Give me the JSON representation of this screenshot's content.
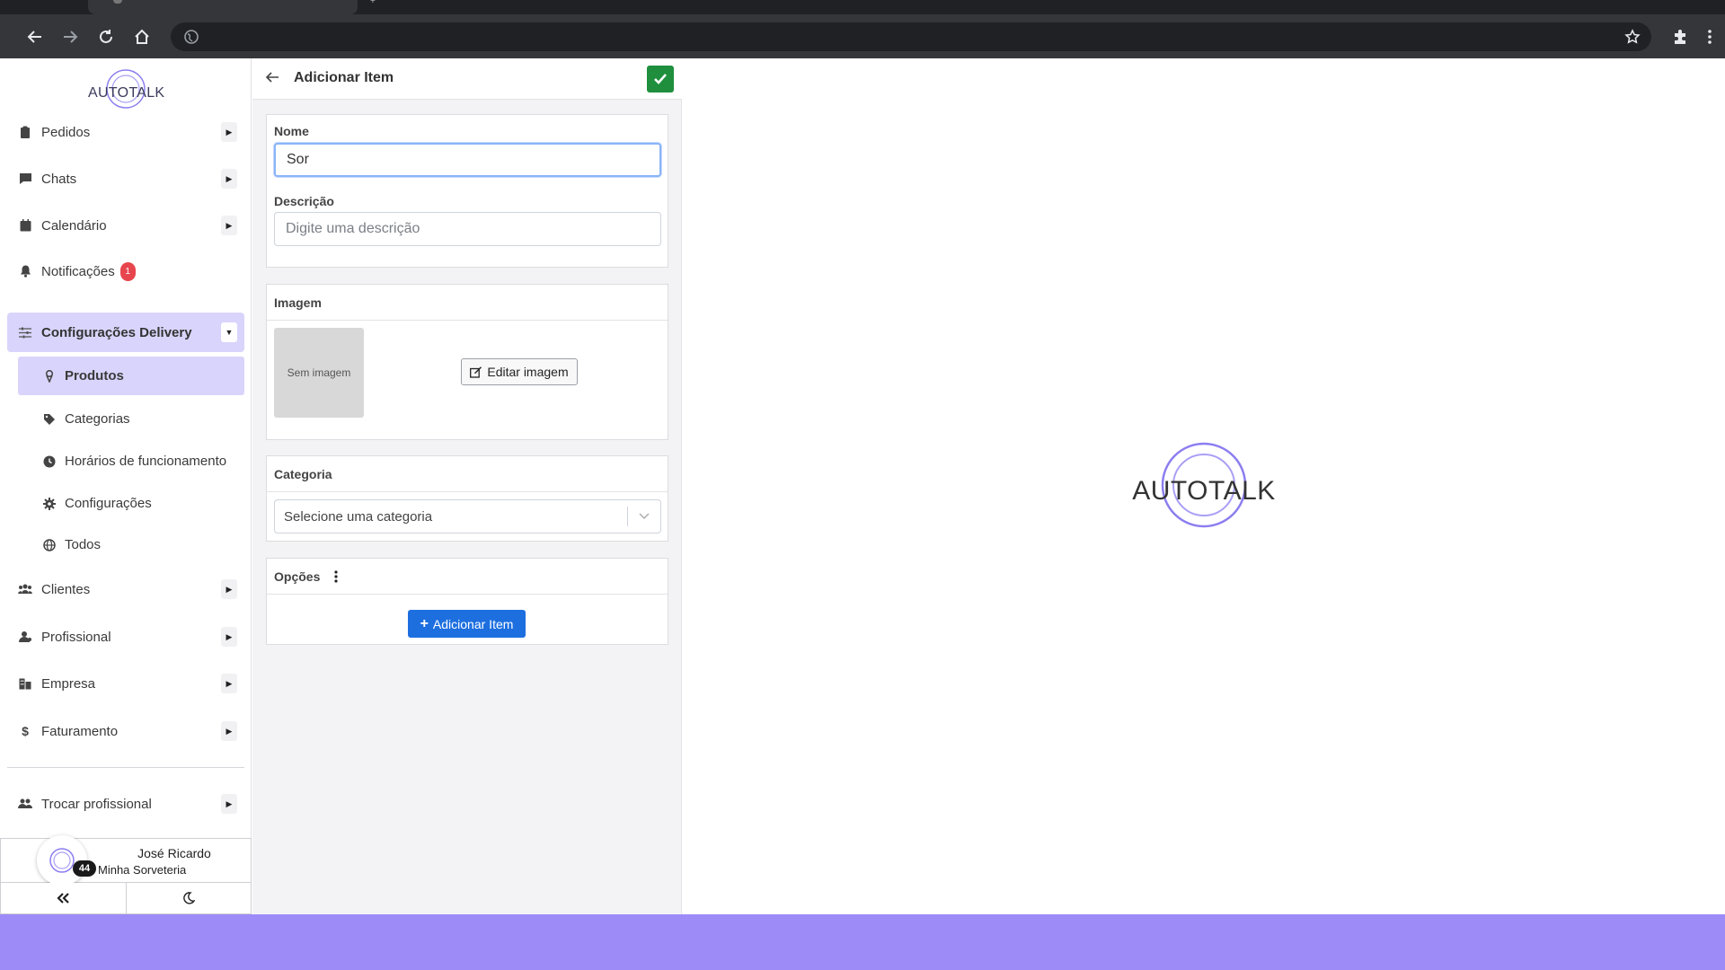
{
  "sidebar": {
    "logo": "AUTOTALK",
    "items": [
      {
        "label": "Pedidos",
        "icon": "clipboard-icon"
      },
      {
        "label": "Chats",
        "icon": "chat-icon"
      },
      {
        "label": "Calendário",
        "icon": "calendar-icon"
      },
      {
        "label": "Notificações",
        "icon": "bell-icon",
        "badge": "1"
      },
      {
        "label": "Configurações Delivery",
        "icon": "sliders-icon",
        "expanded": true
      }
    ],
    "sub_items": [
      {
        "label": "Produtos",
        "icon": "ice-cream-icon",
        "active": true
      },
      {
        "label": "Categorias",
        "icon": "tag-icon"
      },
      {
        "label": "Horários de funcionamento",
        "icon": "clock-icon"
      },
      {
        "label": "Configurações",
        "icon": "gear-icon"
      },
      {
        "label": "Todos",
        "icon": "globe-icon"
      }
    ],
    "lower_items": [
      {
        "label": "Clientes",
        "icon": "users-icon"
      },
      {
        "label": "Profissional",
        "icon": "user-tie-icon"
      },
      {
        "label": "Empresa",
        "icon": "building-icon"
      },
      {
        "label": "Faturamento",
        "icon": "dollar-icon"
      }
    ],
    "switch_label": "Trocar profissional",
    "user": {
      "name": "José Ricardo",
      "company": "Minha Sorveteria",
      "count": "44"
    }
  },
  "form": {
    "title": "Adicionar Item",
    "name_label": "Nome",
    "name_value": "Sor",
    "description_label": "Descrição",
    "description_placeholder": "Digite uma descrição",
    "image_header": "Imagem",
    "no_image": "Sem imagem",
    "edit_image": "Editar imagem",
    "category_header": "Categoria",
    "category_placeholder": "Selecione uma categoria",
    "options_header": "Opções",
    "add_item": "Adicionar Item"
  },
  "canvas": {
    "logo": "AUTOTALK"
  },
  "colors": {
    "accent": "#9d8bf8",
    "active_bg": "#d9d4fb",
    "confirm": "#1f8f3e",
    "primary_btn": "#1d6fe0",
    "badge": "#e8464e"
  }
}
